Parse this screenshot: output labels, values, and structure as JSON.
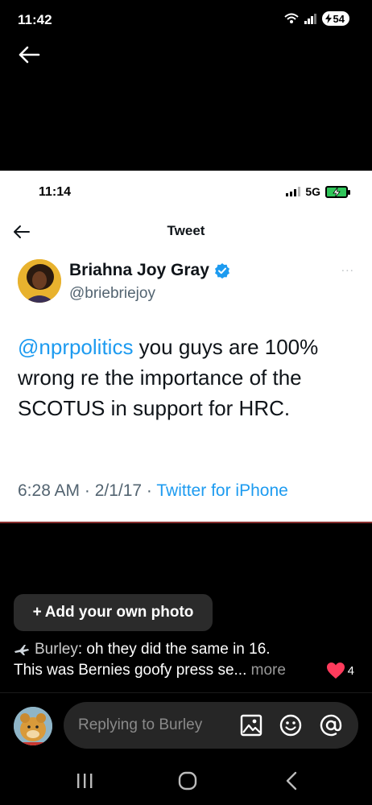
{
  "status_bar": {
    "time": "11:42",
    "battery": "54"
  },
  "screenshot": {
    "status_time": "11:14",
    "network": "5G",
    "header_title": "Tweet",
    "author_name": "Briahna Joy Gray",
    "author_handle": "@briebriejoy",
    "tweet_mention": "@nprpolitics",
    "tweet_text": " you guys are 100% wrong re the importance of the SCOTUS in support for HRC.",
    "timestamp": "6:28 AM · 2/1/17 · ",
    "source": "Twitter for iPhone",
    "more_icon": "..."
  },
  "add_photo": {
    "plus": "+",
    "label": "Add your own photo"
  },
  "comment": {
    "author": "Burley",
    "text_line1": ": oh they did the same in 16.",
    "text_line2": "This was Bernies goofy press se... ",
    "more_label": "more",
    "like_count": "4",
    "heart_color": "#ff3b5c"
  },
  "reply": {
    "placeholder": "Replying to Burley"
  },
  "colors": {
    "link": "#1d9bf0",
    "verified": "#1d9bf0"
  }
}
